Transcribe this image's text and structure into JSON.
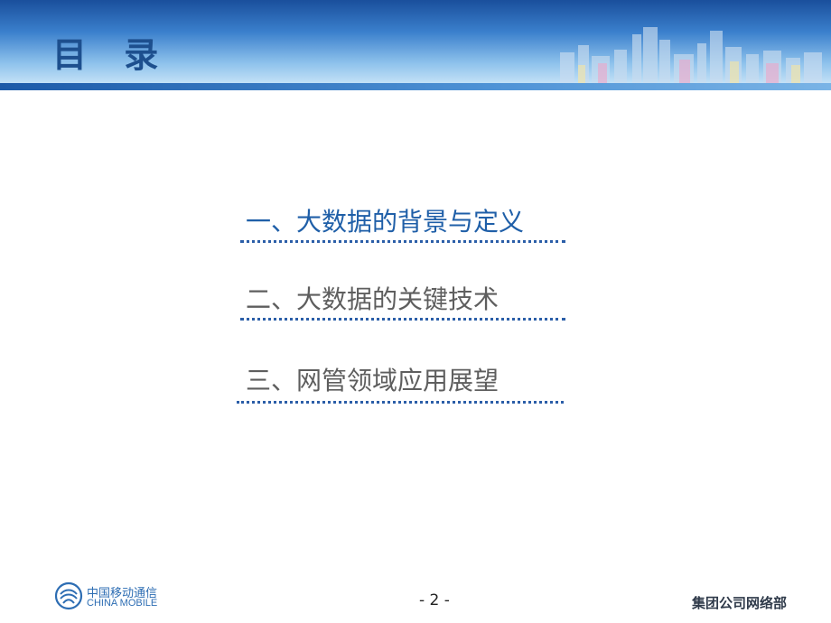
{
  "header": {
    "title": "目 录"
  },
  "toc": {
    "items": [
      {
        "label": "一、大数据的背景与定义",
        "state": "active"
      },
      {
        "label": "二、大数据的关键技术",
        "state": "inactive"
      },
      {
        "label": "三、网管领域应用展望",
        "state": "inactive"
      }
    ]
  },
  "footer": {
    "logo_cn": "中国移动通信",
    "logo_en": "CHINA MOBILE",
    "page_number": "- 2 -",
    "department": "集团公司网络部"
  },
  "colors": {
    "title": "#1d4f8e",
    "active_item": "#1f5fa8",
    "inactive_item": "#5e5e5e",
    "divider": "#2b5ea8",
    "brand": "#2d6db3"
  }
}
